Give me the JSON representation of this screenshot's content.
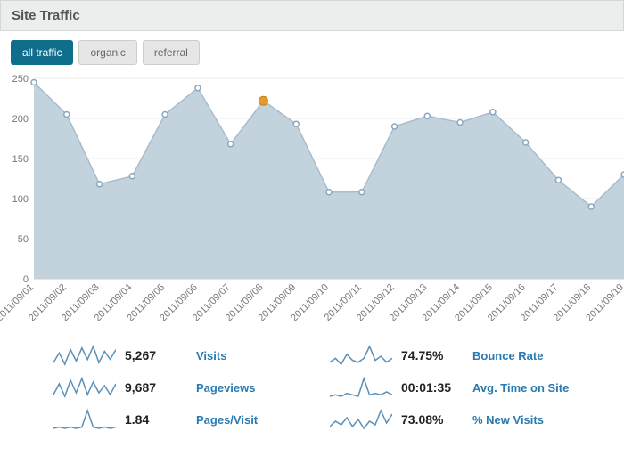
{
  "header": {
    "title": "Site Traffic"
  },
  "tabs": [
    {
      "label": "all traffic",
      "active": true
    },
    {
      "label": "organic",
      "active": false
    },
    {
      "label": "referral",
      "active": false
    }
  ],
  "chart_data": {
    "type": "line",
    "title": "",
    "xlabel": "",
    "ylabel": "",
    "ylim": [
      0,
      250
    ],
    "yticks": [
      0,
      50,
      100,
      150,
      200,
      250
    ],
    "categories": [
      "2011/09/01",
      "2011/09/02",
      "2011/09/03",
      "2011/09/04",
      "2011/09/05",
      "2011/09/06",
      "2011/09/07",
      "2011/09/08",
      "2011/09/09",
      "2011/09/10",
      "2011/09/11",
      "2011/09/12",
      "2011/09/13",
      "2011/09/14",
      "2011/09/15",
      "2011/09/16",
      "2011/09/17",
      "2011/09/18",
      "2011/09/19"
    ],
    "series": [
      {
        "name": "all traffic",
        "values": [
          245,
          205,
          118,
          128,
          205,
          238,
          168,
          222,
          193,
          108,
          108,
          190,
          203,
          195,
          208,
          170,
          123,
          90,
          130
        ]
      }
    ],
    "highlight_index": 7
  },
  "metrics": [
    {
      "value": "5,267",
      "label": "Visits",
      "spark": [
        8,
        14,
        7,
        16,
        9,
        17,
        10,
        18,
        8,
        15,
        10,
        16
      ]
    },
    {
      "value": "74.75%",
      "label": "Bounce Rate",
      "spark": [
        10,
        12,
        9,
        14,
        11,
        10,
        12,
        18,
        11,
        13,
        10,
        12
      ]
    },
    {
      "value": "9,687",
      "label": "Pageviews",
      "spark": [
        9,
        15,
        8,
        17,
        10,
        18,
        9,
        16,
        10,
        14,
        9,
        15
      ]
    },
    {
      "value": "00:01:35",
      "label": "Avg. Time on Site",
      "spark": [
        8,
        9,
        8,
        10,
        9,
        8,
        20,
        9,
        10,
        9,
        11,
        9
      ]
    },
    {
      "value": "1.84",
      "label": "Pages/Visit",
      "spark": [
        8,
        9,
        8,
        9,
        8,
        9,
        22,
        9,
        8,
        9,
        8,
        9
      ]
    },
    {
      "value": "73.08%",
      "label": "% New Visits",
      "spark": [
        9,
        12,
        10,
        14,
        9,
        13,
        8,
        12,
        10,
        18,
        11,
        16
      ]
    }
  ]
}
